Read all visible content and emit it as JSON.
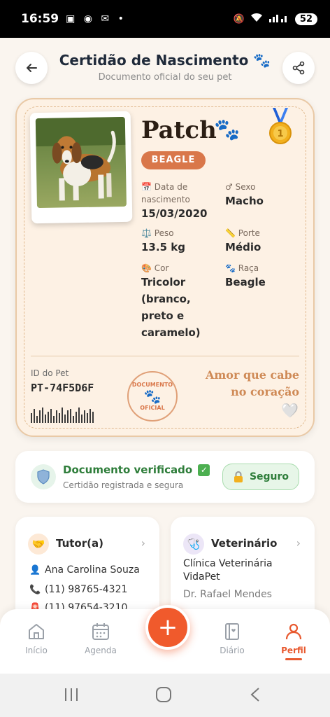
{
  "status_bar": {
    "time": "16:59",
    "battery": "52"
  },
  "header": {
    "title": "Certidão de Nascimento 🐾",
    "subtitle": "Documento oficial do seu pet"
  },
  "pet": {
    "name": "Patch",
    "paws": "🐾",
    "breed_badge": "BEAGLE",
    "birth_label_1": "📅 Data de",
    "birth_label_2": "nascimento",
    "birth_value": "15/03/2020",
    "sex_label": "♂ Sexo",
    "sex_value": "Macho",
    "weight_label": "⚖️ Peso",
    "weight_value": "13.5 kg",
    "size_label": "📏 Porte",
    "size_value": "Médio",
    "color_label": "🎨 Cor",
    "color_value_1": "Tricolor",
    "color_value_2": "(branco,",
    "color_value_3": "preto e",
    "color_value_4": "caramelo)",
    "breed_label": "🐾 Raça",
    "breed_value": "Beagle"
  },
  "certificate": {
    "id_label": "ID do Pet",
    "id_value": "PT-74F5D6F",
    "stamp_top": "DOCUMENTO",
    "stamp_bottom": "OFICIAL",
    "motto_1": "Amor que cabe",
    "motto_2": "no coração",
    "heart": "🤍"
  },
  "verification": {
    "title": "Documento verificado",
    "check": "✓",
    "subtitle": "Certidão registrada e segura",
    "button": "Seguro"
  },
  "tutor": {
    "title": "Tutor(a)",
    "name": "Ana Carolina Souza",
    "phone1": "(11) 98765-4321",
    "phone2": "(11) 97654-3210"
  },
  "vet": {
    "title": "Veterinário",
    "clinic_1": "Clínica Veterinária",
    "clinic_2": "VidaPet",
    "doctor": "Dr. Rafael Mendes"
  },
  "nav": {
    "items": [
      {
        "label": "Início"
      },
      {
        "label": "Agenda"
      },
      {
        "label": "Diário"
      },
      {
        "label": "Perfil"
      }
    ],
    "fab": "+"
  },
  "colors": {
    "accent": "#f05a2c",
    "badge": "#d9774a",
    "verified": "#2e7d3a",
    "certificate_bg": "#fdf1e4"
  }
}
